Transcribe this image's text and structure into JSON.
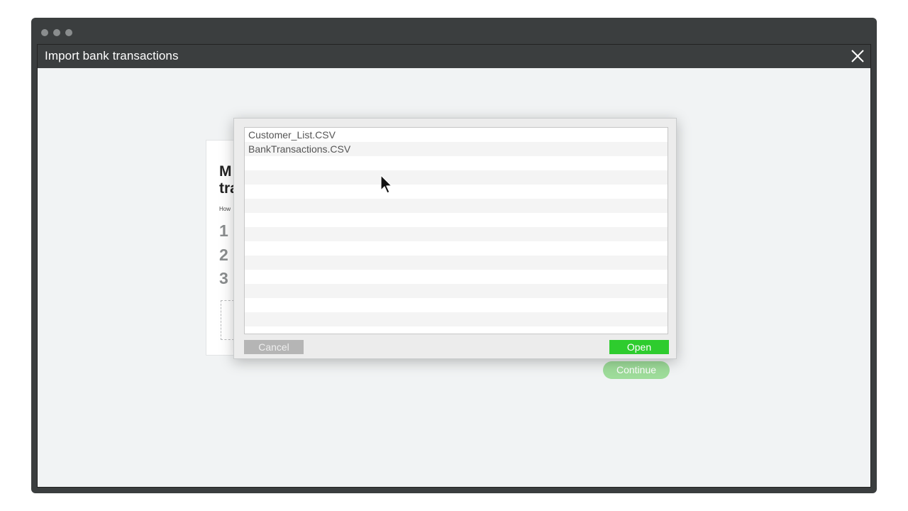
{
  "app": {
    "title": "Import bank transactions",
    "close_icon": "close-icon"
  },
  "background_card": {
    "heading": "M\ntra",
    "subtext": "How",
    "steps": [
      "1",
      "2",
      "3"
    ],
    "continue_label": "Continue"
  },
  "file_dialog": {
    "files": [
      "Customer_List.CSV",
      "BankTransactions.CSV",
      "",
      "",
      "",
      "",
      "",
      "",
      "",
      "",
      "",
      "",
      "",
      ""
    ],
    "cancel_label": "Cancel",
    "open_label": "Open"
  },
  "colors": {
    "open_button": "#2ecc2e",
    "continue_button_disabled": "#9edc9a",
    "cancel_button": "#b5b5b5",
    "header": "#3b3e3f"
  }
}
